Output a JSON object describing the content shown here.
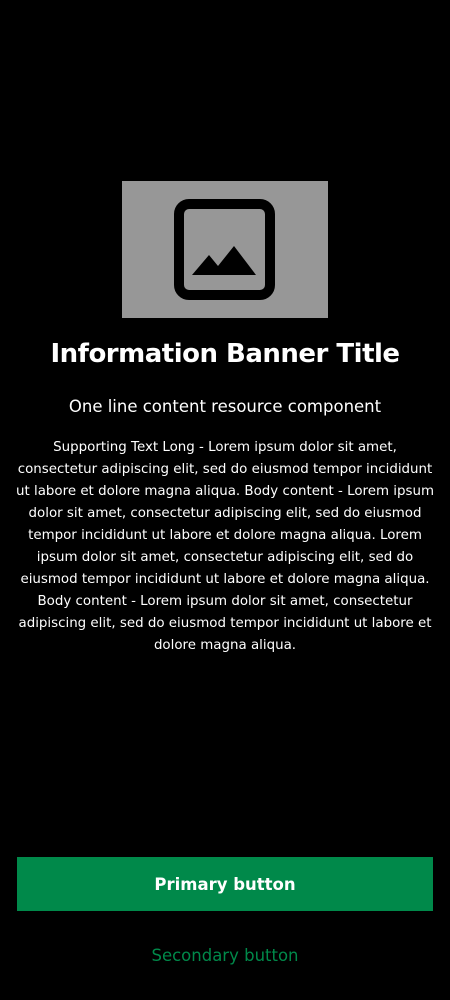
{
  "banner": {
    "image_icon": "image-placeholder-icon",
    "image_background": "#979797",
    "title": "Information Banner Title",
    "subtitle": "One line content resource component",
    "body": "Supporting Text Long - Lorem ipsum dolor sit amet, consectetur adipiscing elit, sed do eiusmod tempor incididunt ut labore et dolore magna aliqua. Body content - Lorem ipsum dolor sit amet, consectetur adipiscing elit, sed do eiusmod tempor incididunt ut labore et dolore magna aliqua. Lorem ipsum dolor sit amet, consectetur adipiscing elit, sed do eiusmod tempor incididunt ut labore et dolore magna aliqua. Body content - Lorem ipsum dolor sit amet, consectetur adipiscing elit, sed do eiusmod tempor incididunt ut labore et dolore magna aliqua."
  },
  "actions": {
    "primary_label": "Primary button",
    "secondary_label": "Secondary button"
  },
  "colors": {
    "background": "#000000",
    "accent": "#00894a",
    "text": "#ffffff"
  }
}
